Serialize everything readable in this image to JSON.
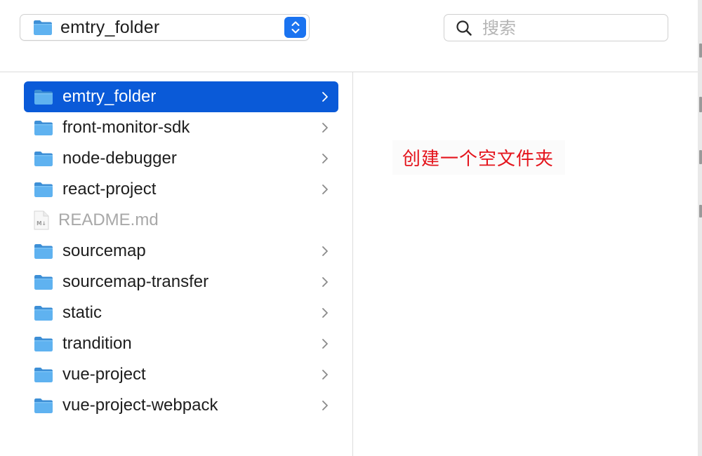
{
  "window": {
    "path_selector": {
      "label": "emtry_folder"
    }
  },
  "search": {
    "placeholder": "搜索",
    "value": ""
  },
  "column": {
    "items": [
      {
        "label": "emtry_folder",
        "kind": "folder",
        "selected": true
      },
      {
        "label": "front-monitor-sdk",
        "kind": "folder"
      },
      {
        "label": "node-debugger",
        "kind": "folder"
      },
      {
        "label": "react-project",
        "kind": "folder"
      },
      {
        "label": "README.md",
        "kind": "file",
        "file_badge": "M↓"
      },
      {
        "label": "sourcemap",
        "kind": "folder"
      },
      {
        "label": "sourcemap-transfer",
        "kind": "folder"
      },
      {
        "label": "static",
        "kind": "folder"
      },
      {
        "label": "trandition",
        "kind": "folder"
      },
      {
        "label": "vue-project",
        "kind": "folder"
      },
      {
        "label": "vue-project-webpack",
        "kind": "folder"
      }
    ]
  },
  "detail": {
    "annotation": "创建一个空文件夹"
  },
  "colors": {
    "accent": "#1a73f0",
    "selection": "#0a5ad8",
    "folder": "#5fb2f0",
    "annotation": "#e4141c"
  },
  "icons": {
    "folder": "folder-icon",
    "file": "markdown-file-icon",
    "stepper": "up-down-chevron-icon",
    "search": "magnifier-icon",
    "disclosure": "chevron-right-icon"
  }
}
